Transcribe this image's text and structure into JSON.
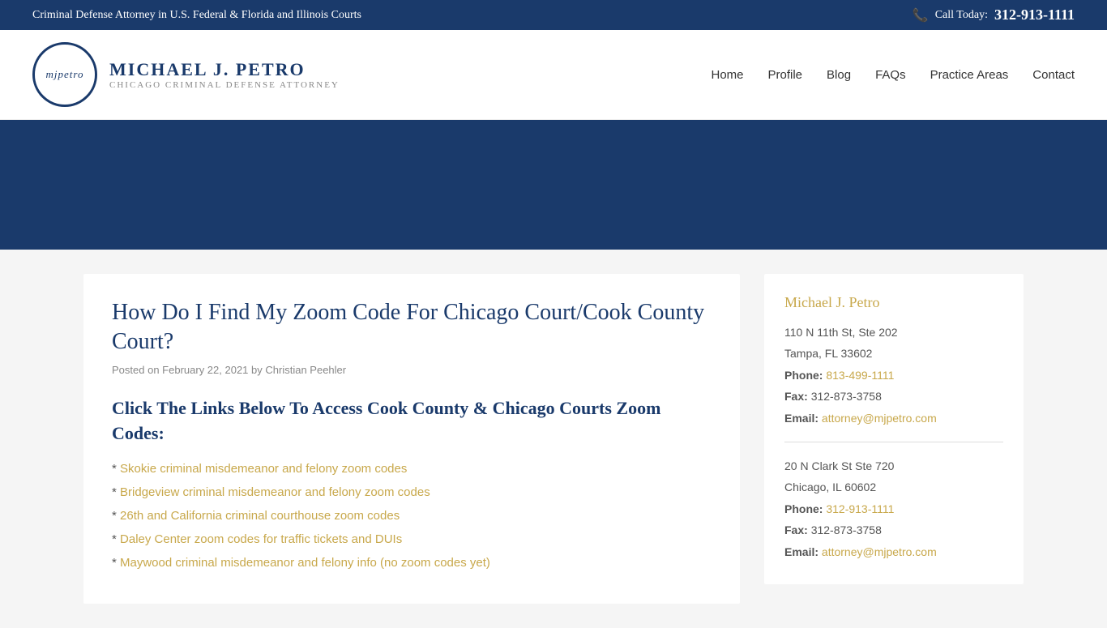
{
  "topBar": {
    "tagline": "Criminal Defense Attorney in U.S. Federal & Florida and Illinois Courts",
    "callLabel": "Call Today:",
    "phone": "312-913-1111"
  },
  "header": {
    "logoInitials": "mjpetro",
    "lawyerName": "MICHAEL J. PETRO",
    "lawyerSubtitle": "CHICAGO CRIMINAL DEFENSE ATTORNEY",
    "nav": [
      {
        "label": "Home",
        "href": "#"
      },
      {
        "label": "Profile",
        "href": "#"
      },
      {
        "label": "Blog",
        "href": "#"
      },
      {
        "label": "FAQs",
        "href": "#"
      },
      {
        "label": "Practice Areas",
        "href": "#"
      },
      {
        "label": "Contact",
        "href": "#"
      }
    ]
  },
  "post": {
    "title": "How Do I Find My Zoom Code For Chicago Court/Cook County Court?",
    "meta_posted": "Posted on",
    "meta_date": "February 22, 2021",
    "meta_by": "by",
    "meta_author": "Christian Peehler",
    "subtitle": "Click The Links Below To Access Cook County & Chicago Courts Zoom Codes:",
    "links": [
      {
        "prefix": "* ",
        "text": "Skokie criminal misdemeanor and felony zoom codes",
        "href": "#"
      },
      {
        "prefix": "* ",
        "text": "Bridgeview criminal misdemeanor and felony zoom codes",
        "href": "#"
      },
      {
        "prefix": "* ",
        "text": "26th and California criminal courthouse zoom codes",
        "href": "#"
      },
      {
        "prefix": "* ",
        "text": "Daley Center zoom codes for traffic tickets and DUIs",
        "href": "#"
      },
      {
        "prefix": "* ",
        "text": "Maywood criminal misdemeanor and felony info (no zoom codes yet)",
        "href": "#"
      }
    ]
  },
  "sidebar": {
    "contact": {
      "name": "Michael J. Petro",
      "address1_line1": "110 N 11th St, Ste 202",
      "address1_line2": "Tampa, FL 33602",
      "phone1_label": "Phone:",
      "phone1": "813-499-1111",
      "fax1_label": "Fax:",
      "fax1": "312-873-3758",
      "email1_label": "Email:",
      "email1": "attorney@mjpetro.com",
      "address2_line1": "20 N Clark St Ste 720",
      "address2_line2": "Chicago, IL 60602",
      "phone2_label": "Phone:",
      "phone2": "312-913-1111",
      "fax2_label": "Fax:",
      "fax2": "312-873-3758",
      "email2_label": "Email:",
      "email2": "attorney@mjpetro.com"
    }
  },
  "colors": {
    "navy": "#1a3a6b",
    "gold": "#c8a84b"
  }
}
